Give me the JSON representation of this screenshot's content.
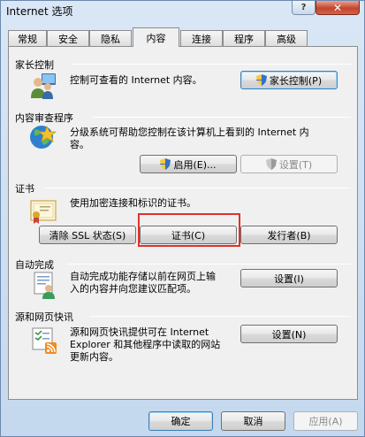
{
  "window": {
    "title": "Internet 选项",
    "help_label": "?",
    "close_label": "✕"
  },
  "tabs": [
    {
      "label": "常规"
    },
    {
      "label": "安全"
    },
    {
      "label": "隐私"
    },
    {
      "label": "内容"
    },
    {
      "label": "连接"
    },
    {
      "label": "程序"
    },
    {
      "label": "高级"
    }
  ],
  "active_tab": "内容",
  "sections": {
    "parental": {
      "title": "家长控制",
      "description": "控制可查看的 Internet 内容。",
      "button": "家长控制(P)",
      "icon": "users-icon"
    },
    "content_advisor": {
      "title": "内容审查程序",
      "description_line1": "分级系统可帮助您控制在该计算机上看到的 Internet 内",
      "description_line2": "容。",
      "enable_button": "启用(E)...",
      "settings_button": "设置(T)",
      "icon": "globe-icon"
    },
    "certificates": {
      "title": "证书",
      "description": "使用加密连接和标识的证书。",
      "clear_ssl_button": "清除 SSL 状态(S)",
      "certificates_button": "证书(C)",
      "publishers_button": "发行者(B)",
      "icon": "certificate-icon"
    },
    "autocomplete": {
      "title": "自动完成",
      "description_line1": "自动完成功能存储以前在网页上输",
      "description_line2": "入的内容并向您建议匹配项。",
      "settings_button": "设置(I)",
      "icon": "autocomplete-icon"
    },
    "feeds": {
      "title": "源和网页快讯",
      "description_line1": "源和网页快讯提供可在 Internet",
      "description_line2": "Explorer 和其他程序中读取的网站",
      "description_line3": "更新内容。",
      "settings_button": "设置(N)",
      "icon": "feeds-icon"
    }
  },
  "footer": {
    "ok_button": "确定",
    "cancel_button": "取消",
    "apply_button": "应用(A)"
  },
  "colors": {
    "highlight": "#e0312f",
    "accent": "#3c7fb1"
  }
}
